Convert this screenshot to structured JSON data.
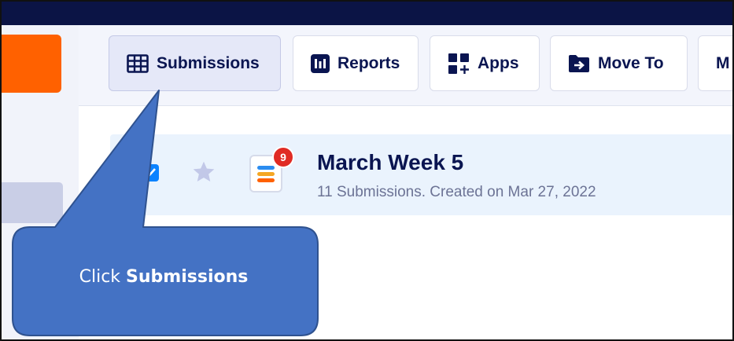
{
  "toolbar": {
    "buttons": [
      {
        "label": "Submissions",
        "icon": "table-grid-icon",
        "active": true
      },
      {
        "label": "Reports",
        "icon": "bar-report-icon"
      },
      {
        "label": "Apps",
        "icon": "apps-grid-plus-icon"
      },
      {
        "label": "Move To",
        "icon": "folder-arrow-icon"
      },
      {
        "label": "M",
        "icon": ""
      }
    ]
  },
  "form": {
    "title": "March Week 5",
    "subtitle": "11 Submissions. Created on Mar 27, 2022",
    "badge_count": "9",
    "checked": true,
    "starred": false
  },
  "callout": {
    "prefix": "Click ",
    "bold": "Submissions"
  },
  "colors": {
    "topbar": "#0b1445",
    "accent_orange": "#ff6100",
    "callout_fill": "#4472c4",
    "callout_border": "#2f528f",
    "text_primary": "#0a1551",
    "row_highlight": "#eaf3fd",
    "badge": "#e02b24",
    "checkbox": "#0a82ff"
  }
}
